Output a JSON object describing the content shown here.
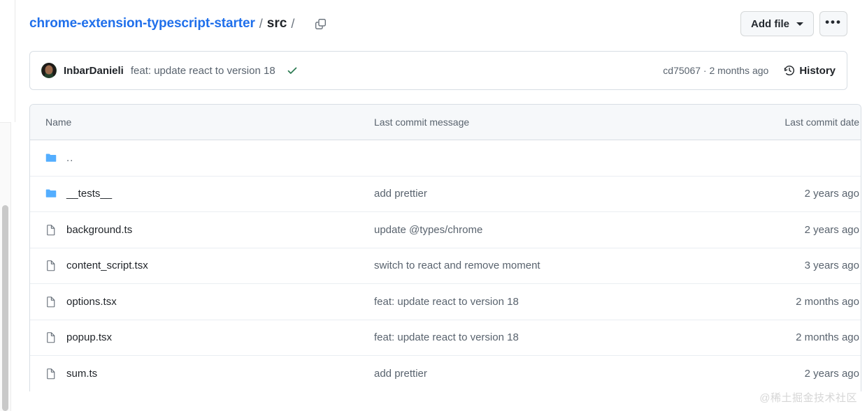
{
  "breadcrumb": {
    "repo": "chrome-extension-typescript-starter",
    "sep1": "/",
    "dir": "src",
    "sep2": "/",
    "copy_icon": "copy-path-icon"
  },
  "header": {
    "add_file_label": "Add file",
    "more_label": "•••",
    "caret_icon": "chevron-down-icon",
    "kebab_icon": "kebab-horizontal-icon"
  },
  "latest_commit": {
    "avatar_alt": "InbarDanieli avatar",
    "author": "InbarDanieli",
    "message": "feat: update react to version 18",
    "status_icon": "check-success-icon",
    "status_color": "#1a7f37",
    "sha": "cd75067",
    "separator": "·",
    "relative_time": "2 months ago",
    "history_label": "History",
    "history_icon": "history-clock-icon"
  },
  "table": {
    "columns": {
      "name": "Name",
      "message": "Last commit message",
      "date": "Last commit date"
    },
    "rows": [
      {
        "icon": "folder-icon",
        "type": "directory",
        "name": "..",
        "message": "",
        "date": ""
      },
      {
        "icon": "folder-icon",
        "type": "directory",
        "name": "__tests__",
        "message": "add prettier",
        "date": "2 years ago"
      },
      {
        "icon": "file-icon",
        "type": "file",
        "name": "background.ts",
        "message": "update @types/chrome",
        "date": "2 years ago"
      },
      {
        "icon": "file-icon",
        "type": "file",
        "name": "content_script.tsx",
        "message": "switch to react and remove moment",
        "date": "3 years ago"
      },
      {
        "icon": "file-icon",
        "type": "file",
        "name": "options.tsx",
        "message": "feat: update react to version 18",
        "date": "2 months ago"
      },
      {
        "icon": "file-icon",
        "type": "file",
        "name": "popup.tsx",
        "message": "feat: update react to version 18",
        "date": "2 months ago"
      },
      {
        "icon": "file-icon",
        "type": "file",
        "name": "sum.ts",
        "message": "add prettier",
        "date": "2 years ago"
      }
    ]
  },
  "watermark": "@稀土掘金技术社区",
  "colors": {
    "link": "#1f6feb",
    "folder": "#54aeff",
    "muted": "#59636e",
    "border": "#d8dee4",
    "header_bg": "#f6f8fa",
    "success": "#1a7f37"
  }
}
